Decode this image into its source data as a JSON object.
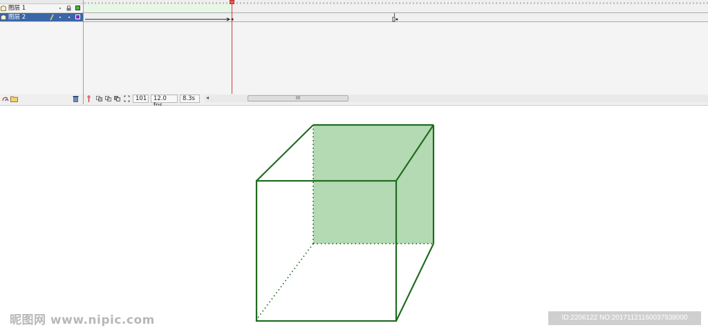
{
  "timeline": {
    "layers": [
      {
        "name": "图层 1",
        "color": "#3fbf3f"
      },
      {
        "name": "图层 2",
        "color": "#7a2fbf"
      }
    ],
    "status": {
      "current_frame": "101",
      "frame_rate": "12.0 fps",
      "elapsed_time": "8.3s"
    },
    "scroll_thumb_grip": "III",
    "scroll_left_arrow": "◂"
  },
  "stage": {
    "shape_stroke_color": "#1f6b1f",
    "shape_fill_color": "#b3dab3"
  },
  "watermark": {
    "left_text": "昵图网 www.nipic.com",
    "right_text": "ID:2206122 NO:20171121160037938000"
  }
}
